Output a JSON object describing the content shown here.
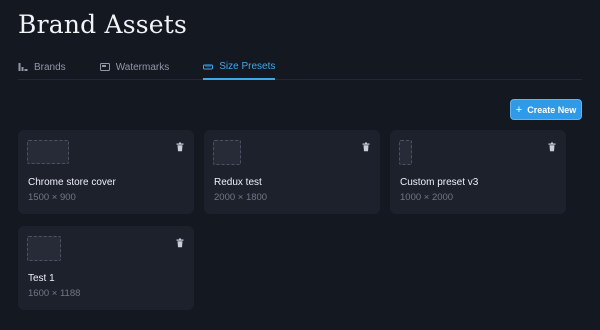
{
  "header": {
    "title": "Brand Assets"
  },
  "tabs": [
    {
      "label": "Brands",
      "icon": "brands-icon",
      "active": false
    },
    {
      "label": "Watermarks",
      "icon": "image-icon",
      "active": false
    },
    {
      "label": "Size Presets",
      "icon": "ruler-icon",
      "active": true
    }
  ],
  "actions": {
    "create_label": "Create New",
    "create_icon": "plus-icon"
  },
  "presets": [
    {
      "name": "Chrome store cover",
      "size": "1500 × 900"
    },
    {
      "name": "Redux test",
      "size": "2000 × 1800"
    },
    {
      "name": "Custom preset v3",
      "size": "1000 × 2000"
    },
    {
      "name": "Test 1",
      "size": "1600 × 1188"
    }
  ],
  "colors": {
    "background": "#141821",
    "card": "#1d212b",
    "accent": "#2f9ae8",
    "tab_active": "#3ea8ef",
    "muted_text": "#8f98a8"
  }
}
